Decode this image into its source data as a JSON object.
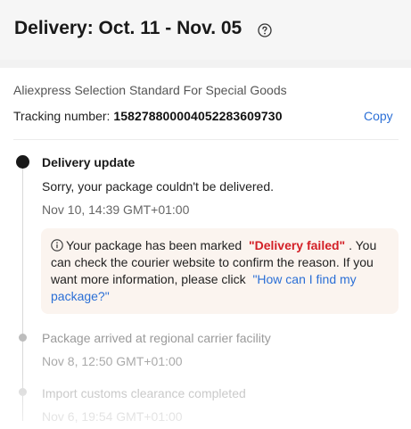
{
  "header": {
    "title": "Delivery: Oct. 11 - Nov. 05",
    "help_icon": "question-circle-icon"
  },
  "shipping": {
    "carrier": "Aliexpress Selection Standard For Special Goods",
    "tracking_label": "Tracking number:",
    "tracking_number": "158278800004052283609730",
    "copy_label": "Copy"
  },
  "timeline": {
    "current": {
      "title": "Delivery update",
      "description": "Sorry, your package couldn't be delivered.",
      "time": "Nov 10, 14:39 GMT+01:00"
    },
    "notice": {
      "icon": "info-circle-icon",
      "text_before": "Your package has been marked",
      "status": "\"Delivery failed\"",
      "text_after": ". You can check the courier website to confirm the reason. If you want more information, please click",
      "link": "\"How can I find my package?\""
    },
    "past": [
      {
        "title": "Package arrived at regional carrier facility",
        "time": "Nov 8, 12:50 GMT+01:00"
      },
      {
        "title": "Import customs clearance completed",
        "time": "Nov 6, 19:54 GMT+01:00"
      }
    ]
  },
  "colors": {
    "link": "#2b6fd6",
    "failed": "#d31f26",
    "notice_bg": "#fbf4ef"
  }
}
